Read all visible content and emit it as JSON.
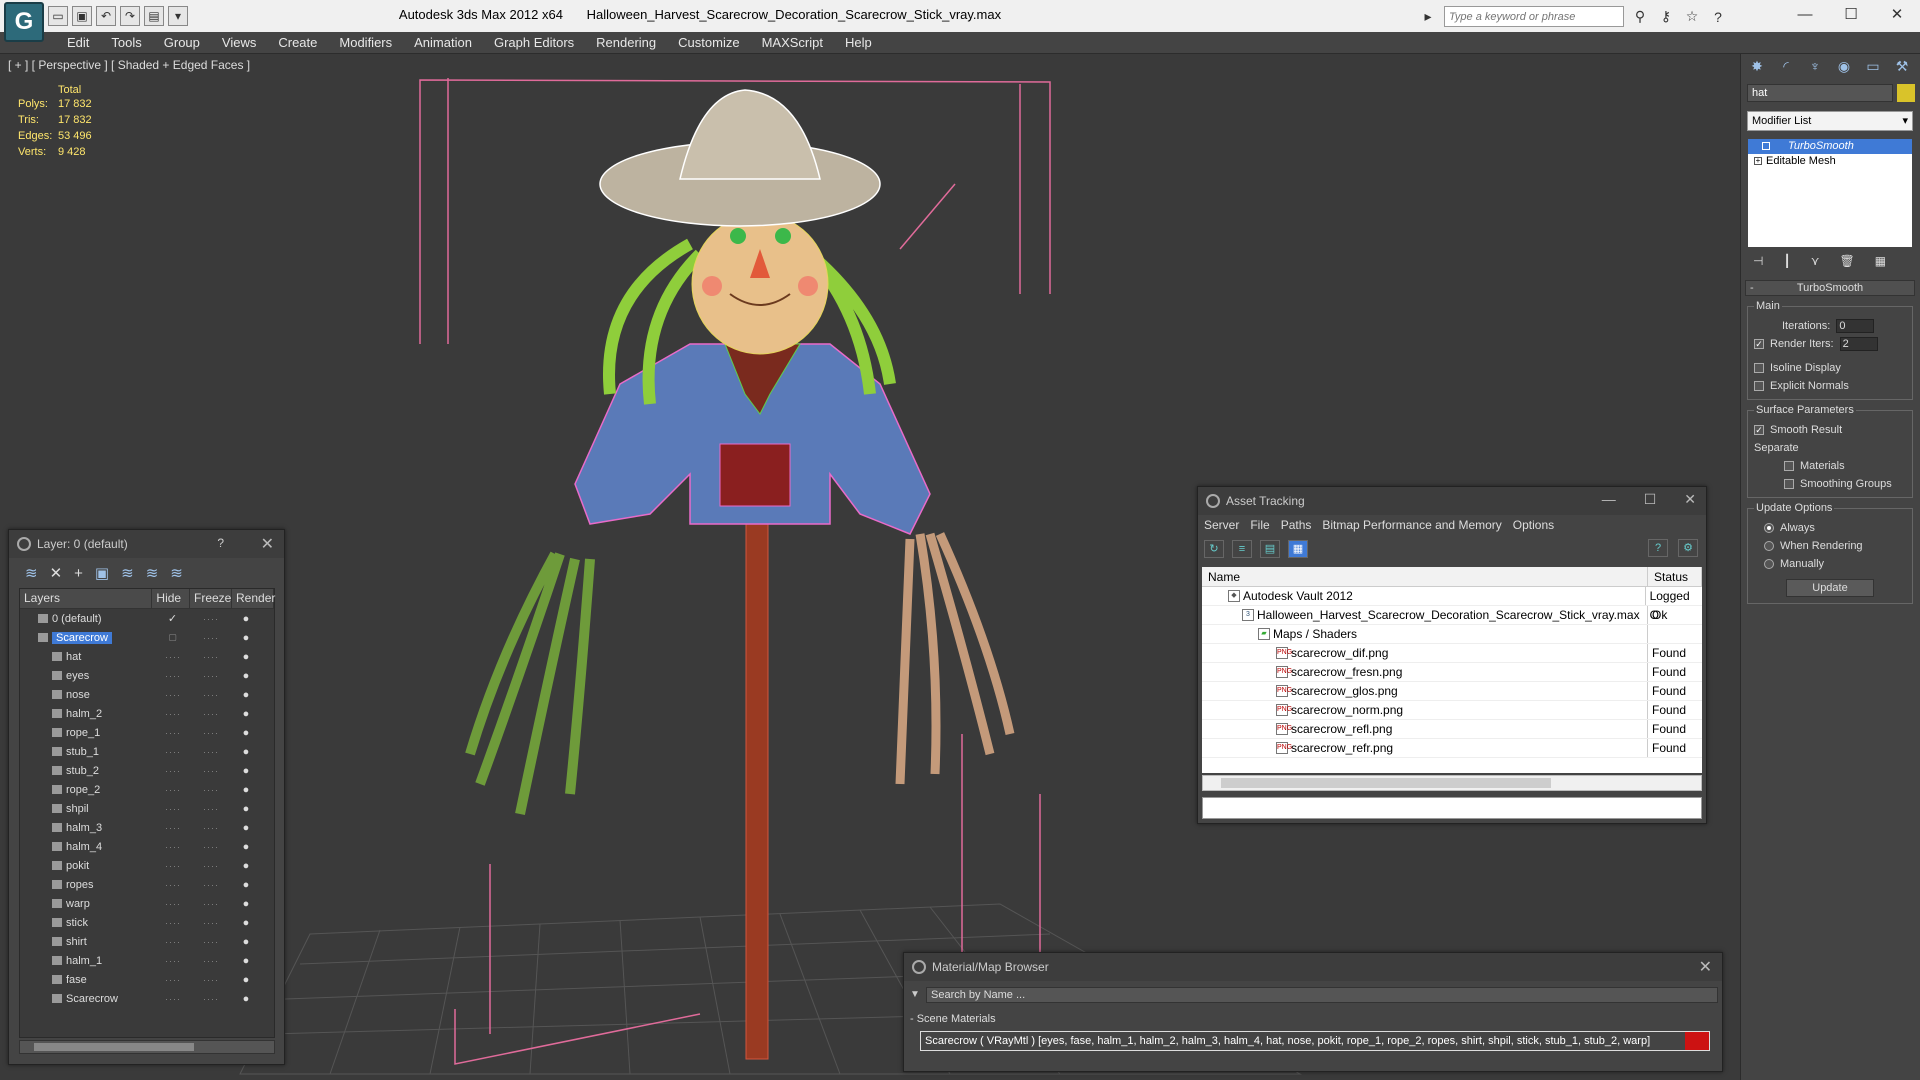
{
  "titlebar": {
    "app": "Autodesk 3ds Max  2012 x64",
    "file": "Halloween_Harvest_Scarecrow_Decoration_Scarecrow_Stick_vray.max",
    "search_placeholder": "Type a keyword or phrase"
  },
  "menu": [
    "Edit",
    "Tools",
    "Group",
    "Views",
    "Create",
    "Modifiers",
    "Animation",
    "Graph Editors",
    "Rendering",
    "Customize",
    "MAXScript",
    "Help"
  ],
  "viewport": {
    "label": "[ + ] [ Perspective ] [ Shaded + Edged Faces ]",
    "stats": {
      "header": "Total",
      "rows": [
        {
          "k": "Polys:",
          "v": "17 832"
        },
        {
          "k": "Tris:",
          "v": "17 832"
        },
        {
          "k": "Edges:",
          "v": "53 496"
        },
        {
          "k": "Verts:",
          "v": "9 428"
        }
      ]
    }
  },
  "layers": {
    "title": "Layer: 0 (default)",
    "help": "?",
    "columns": [
      "Layers",
      "Hide",
      "Freeze",
      "Render"
    ],
    "rows": [
      "0 (default)",
      "Scarecrow",
      "hat",
      "eyes",
      "nose",
      "halm_2",
      "rope_1",
      "stub_1",
      "stub_2",
      "rope_2",
      "shpil",
      "halm_3",
      "halm_4",
      "pokit",
      "ropes",
      "warp",
      "stick",
      "shirt",
      "halm_1",
      "fase",
      "Scarecrow"
    ]
  },
  "asset": {
    "title": "Asset Tracking",
    "menu": [
      "Server",
      "File",
      "Paths",
      "Bitmap Performance and Memory",
      "Options"
    ],
    "columns": [
      "Name",
      "Status"
    ],
    "rows": [
      {
        "name": "Autodesk Vault 2012",
        "status": "Logged O"
      },
      {
        "name": "Halloween_Harvest_Scarecrow_Decoration_Scarecrow_Stick_vray.max",
        "status": "Ok"
      },
      {
        "name": "Maps / Shaders",
        "status": ""
      },
      {
        "name": "scarecrow_dif.png",
        "status": "Found"
      },
      {
        "name": "scarecrow_fresn.png",
        "status": "Found"
      },
      {
        "name": "scarecrow_glos.png",
        "status": "Found"
      },
      {
        "name": "scarecrow_norm.png",
        "status": "Found"
      },
      {
        "name": "scarecrow_refl.png",
        "status": "Found"
      },
      {
        "name": "scarecrow_refr.png",
        "status": "Found"
      }
    ]
  },
  "material": {
    "title": "Material/Map Browser",
    "search": "Search by Name ...",
    "section": "- Scene Materials",
    "entry": "Scarecrow  ( VRayMtl )  [eyes, fase, halm_1, halm_2, halm_3, halm_4, hat, nose, pokit, rope_1, rope_2, ropes, shirt, shpil, stick, stub_1, stub_2, warp]"
  },
  "command": {
    "object_name": "hat",
    "object_color": "#d9c32a",
    "modifier_list": "Modifier List",
    "stack": [
      "TurboSmooth",
      "Editable Mesh"
    ],
    "rollout_title": "TurboSmooth",
    "main_label": "Main",
    "iterations_label": "Iterations:",
    "iterations": "0",
    "render_iters_label": "Render Iters:",
    "render_iters": "2",
    "isoline": "Isoline Display",
    "explicit": "Explicit Normals",
    "surface_label": "Surface Parameters",
    "smooth_result": "Smooth Result",
    "separate_label": "Separate",
    "materials": "Materials",
    "smoothing_groups": "Smoothing Groups",
    "update_label": "Update Options",
    "always": "Always",
    "when_rendering": "When Rendering",
    "manually": "Manually",
    "update_button": "Update"
  }
}
